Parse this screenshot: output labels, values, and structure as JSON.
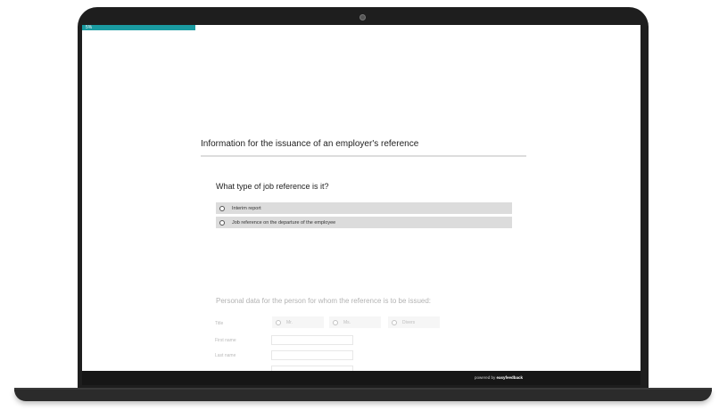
{
  "progress": {
    "label": "5%",
    "value_percent": 5,
    "color": "#1a9ba1"
  },
  "section": {
    "title": "Information for the issuance of an employer's reference"
  },
  "question1": {
    "title": "What type of job reference is it?",
    "options": [
      {
        "label": "Interim report"
      },
      {
        "label": "Job reference on the departure of the employee"
      }
    ]
  },
  "question2": {
    "title": "Personal data for the person for whom the reference is to be issued:",
    "fields": {
      "title_label": "Title",
      "title_options": [
        "Mr.",
        "Ms.",
        "Divers"
      ],
      "first_name_label": "First name",
      "last_name_label": "Last name"
    }
  },
  "footer": {
    "powered_prefix": "powered by ",
    "brand": "easyfeedback"
  },
  "icons": {
    "radio": "radio-button-icon",
    "camera": "camera-icon"
  }
}
